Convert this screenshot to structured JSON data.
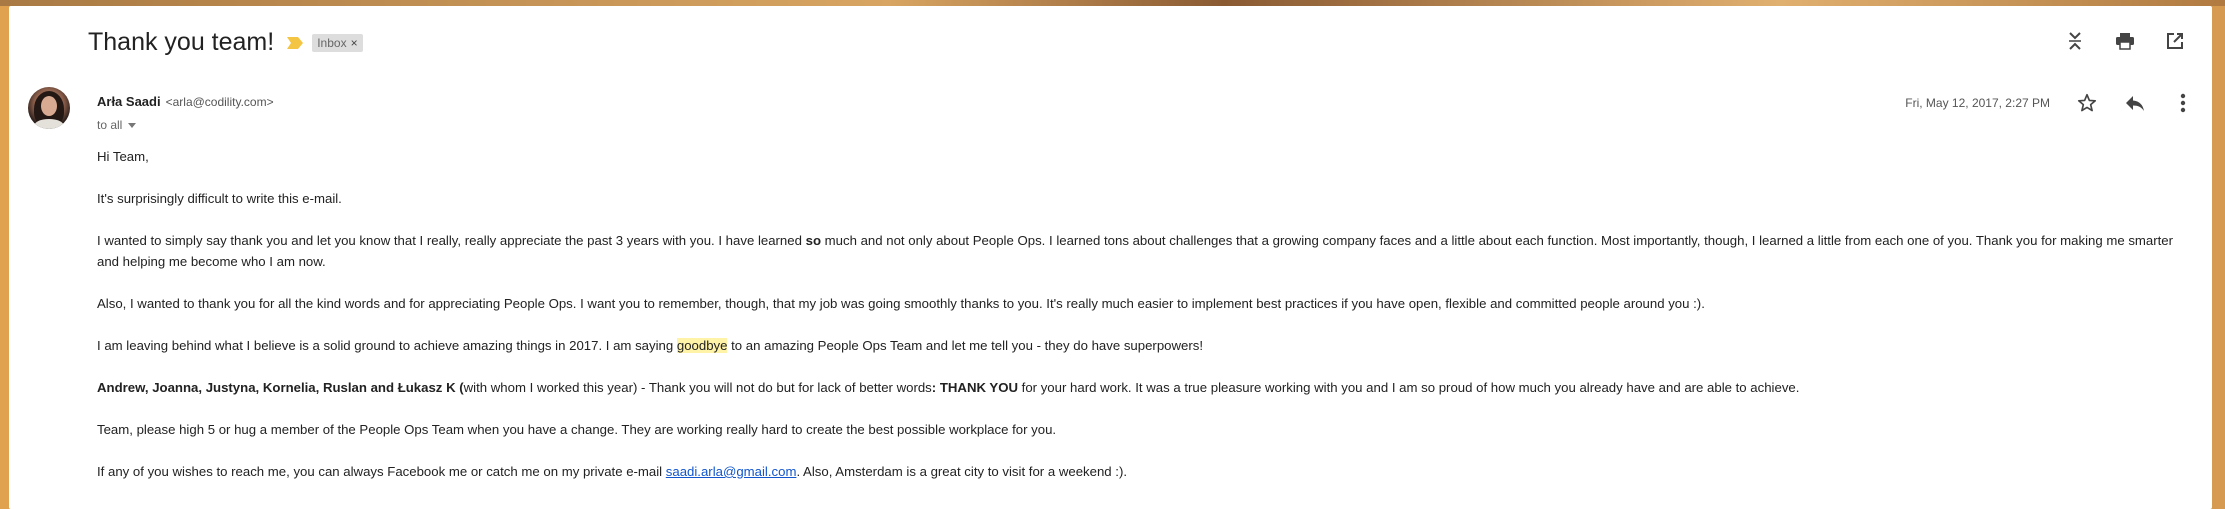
{
  "email": {
    "subject": "Thank you team!",
    "label": "Inbox",
    "label_remove": "×",
    "sender": {
      "name": "Arła Saadi",
      "email": "<arla@codility.com>"
    },
    "recipients": "to all",
    "date": "Fri, May 12, 2017, 2:27 PM"
  },
  "icons": {
    "importance": "importance-marker-icon",
    "expand": "expand-all-icon",
    "print": "print-icon",
    "popout": "open-in-new-window-icon",
    "star": "star-icon",
    "reply": "reply-icon",
    "more": "more-vert-icon"
  },
  "colors": {
    "link": "#1155cc",
    "highlight": "#fff3a8",
    "importance": "#f4c542"
  },
  "body": {
    "greeting": "Hi Team,",
    "p1": "It's surprisingly difficult to write this e-mail.",
    "p2_a": "I wanted to simply say thank you and let you know that I really, really appreciate the past 3 years with you. I have learned ",
    "p2_b": "so",
    "p2_c": " much and not only about People Ops. I learned tons about challenges that a growing company faces and a little about each function. Most importantly, though, I learned a little from each one of you. Thank you for making me smarter and helping me become who I am now.",
    "p3": "Also, I wanted to thank you for all the kind words and for appreciating People Ops. I want you to remember, though, that my job was going smoothly thanks to you. It's really much easier to implement best practices if you have open, flexible and committed people around you :).",
    "p4_a": "I am leaving behind what I believe is a solid ground to achieve amazing things in 2017. I am saying ",
    "p4_b": "goodbye",
    "p4_c": " to an amazing People Ops Team and let me tell you - they do have superpowers!",
    "p5_a": "Andrew, Joanna, Justyna, Kornelia, Ruslan and Łukasz K (",
    "p5_b": "with whom I worked this year) - Thank you will not do but for lack of better words",
    "p5_c": ": THANK YOU",
    "p5_d": " for your hard work. It was a true pleasure working with you and I am so proud of how much you already have and are able to achieve.",
    "p6": "Team, please high 5 or hug a member of the People Ops Team when you have a change. They are working really hard to create the best possible workplace for you.",
    "p7_a": "If any of you wishes to reach me, you can always Facebook me or catch me on my private e-mail ",
    "p7_link": "saadi.arla@gmail.com",
    "p7_b": ". Also, Amsterdam is a great city to visit for a weekend :)."
  }
}
